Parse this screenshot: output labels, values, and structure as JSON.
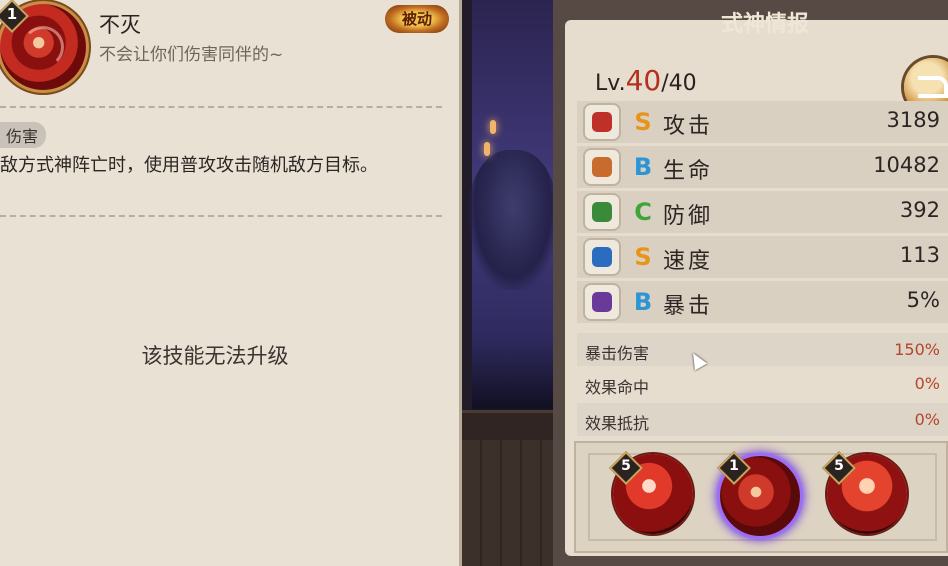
{
  "skill": {
    "level": "1",
    "name": "不灭",
    "quote": "不会让你们伤害同伴的~",
    "type_badge": "被动",
    "tag": "伤害",
    "effect": "敌方式神阵亡时，使用普攻攻击随机敌方目标。",
    "no_upgrade": "该技能无法升级"
  },
  "info_panel": {
    "title": "式神情报",
    "level_label": "Lv.",
    "level_current": "40",
    "level_max": "/40",
    "stats": [
      {
        "grade": "S",
        "grade_color": "#e8931a",
        "label": "攻击",
        "value": "3189",
        "icon": "fan-icon",
        "icon_color": "#c0302a"
      },
      {
        "grade": "B",
        "grade_color": "#2b95d6",
        "label": "生命",
        "value": "10482",
        "icon": "talisman-icon",
        "icon_color": "#c96a2e"
      },
      {
        "grade": "C",
        "grade_color": "#3fa53a",
        "label": "防御",
        "value": "392",
        "icon": "armor-icon",
        "icon_color": "#3b8a3a"
      },
      {
        "grade": "S",
        "grade_color": "#e8931a",
        "label": "速度",
        "value": "113",
        "icon": "speed-arrow-icon",
        "icon_color": "#2b6cc0"
      },
      {
        "grade": "B",
        "grade_color": "#2b95d6",
        "label": "暴击",
        "value": "5%",
        "icon": "crit-scroll-icon",
        "icon_color": "#6a3a9a"
      }
    ],
    "sub_stats": [
      {
        "label": "暴击伤害",
        "value": "150%"
      },
      {
        "label": "效果命中",
        "value": "0%"
      },
      {
        "label": "效果抵抗",
        "value": "0%"
      }
    ],
    "skills": [
      {
        "level": "5"
      },
      {
        "level": "1"
      },
      {
        "level": "5"
      }
    ]
  }
}
